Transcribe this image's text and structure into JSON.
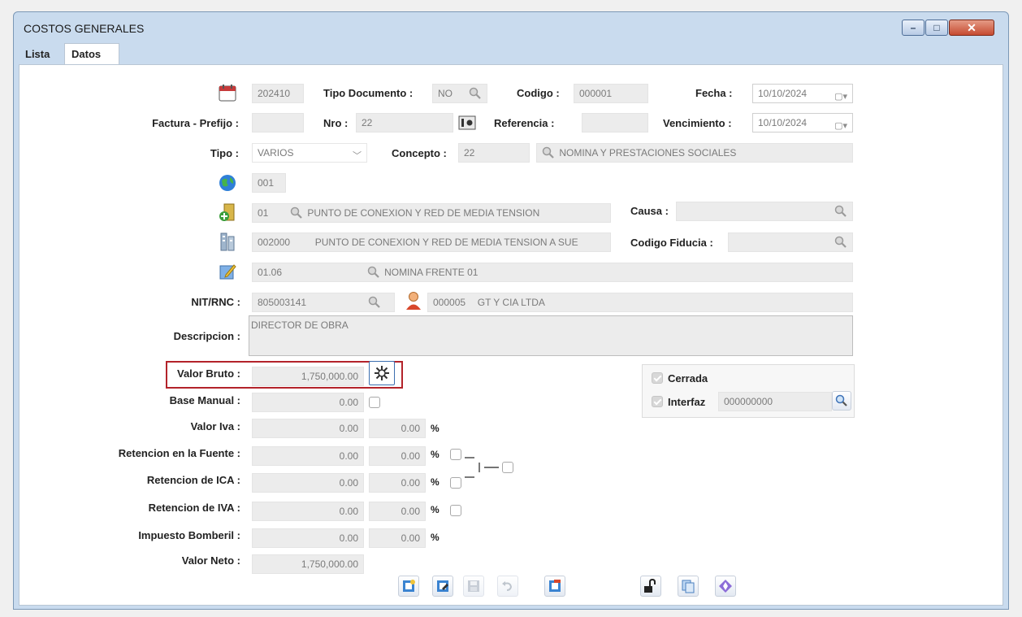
{
  "window": {
    "title": "COSTOS GENERALES",
    "min": "–",
    "max": "□",
    "close": "✕"
  },
  "tabs": [
    "Lista",
    "Datos"
  ],
  "form": {
    "periodo": "202410",
    "tipo_documento": {
      "label": "Tipo Documento :",
      "value": "NO"
    },
    "codigo": {
      "label": "Codigo :",
      "value": "000001"
    },
    "fecha": {
      "label": "Fecha :",
      "value": "10/10/2024"
    },
    "factura_prefijo": {
      "label": "Factura - Prefijo :",
      "value": ""
    },
    "nro": {
      "label": "Nro :",
      "value": "22"
    },
    "referencia": {
      "label": "Referencia :",
      "value": ""
    },
    "vencimiento": {
      "label": "Vencimiento :",
      "value": "10/10/2024"
    },
    "tipo": {
      "label": "Tipo :",
      "value": "VARIOS"
    },
    "concepto": {
      "label": "Concepto :",
      "code": "22",
      "name": "NOMINA Y PRESTACIONES SOCIALES"
    },
    "region": "001",
    "proyecto": {
      "code": "01",
      "name": "PUNTO DE CONEXION Y RED DE MEDIA TENSION"
    },
    "causa": {
      "label": "Causa :",
      "value": ""
    },
    "subproyecto": {
      "code": "002000",
      "name": "PUNTO DE CONEXION Y RED DE MEDIA TENSION A SUE"
    },
    "codigo_fiducia": {
      "label": "Codigo Fiducia :",
      "value": ""
    },
    "actividad": {
      "code": "01.06",
      "name": "NOMINA FRENTE 01"
    },
    "nit": {
      "label": "NIT/RNC :",
      "value": "805003141",
      "tercero_code": "000005",
      "tercero_name": "GT Y CIA LTDA"
    },
    "descripcion": {
      "label": "Descripcion :",
      "value": "DIRECTOR DE OBRA"
    },
    "valor_bruto": {
      "label": "Valor Bruto :",
      "value": "1,750,000.00"
    },
    "base_manual": {
      "label": "Base Manual :",
      "value": "0.00"
    },
    "valor_iva": {
      "label": "Valor Iva :",
      "value": "0.00",
      "pct": "0.00"
    },
    "ret_fuente": {
      "label": "Retencion en la Fuente :",
      "value": "0.00",
      "pct": "0.00"
    },
    "ret_ica": {
      "label": "Retencion de ICA :",
      "value": "0.00",
      "pct": "0.00"
    },
    "ret_iva": {
      "label": "Retencion de IVA :",
      "value": "0.00",
      "pct": "0.00"
    },
    "impuesto_bomberil": {
      "label": "Impuesto Bomberil :",
      "value": "0.00",
      "pct": "0.00"
    },
    "valor_neto": {
      "label": "Valor Neto :",
      "value": "1,750,000.00"
    },
    "pct_symbol": "%",
    "cerrada": {
      "label": "Cerrada"
    },
    "interfaz": {
      "label": "Interfaz",
      "value": "000000000"
    }
  }
}
